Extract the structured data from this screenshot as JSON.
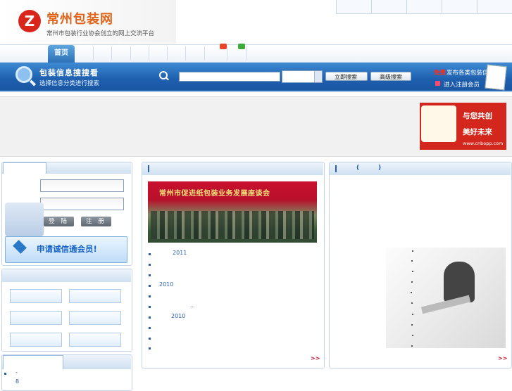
{
  "header": {
    "logo_glyph": "Z",
    "site_name": "常州包装网",
    "slogan": "常州市包装行业协会创立的网上交流平台"
  },
  "nav": {
    "home": "首页"
  },
  "search": {
    "title": "包装信息搜搜看",
    "subtitle": "选择信息分类进行搜索",
    "input_value": "",
    "search_button": "立即搜索",
    "advanced_button": "高级搜索",
    "free_label": "免费",
    "publish_label": "发布各类包装信息",
    "member_label": "进入注册会员"
  },
  "banner_ad": {
    "line1": "与您共创",
    "line2": "美好未来",
    "url": "www.cnbopp.com"
  },
  "login": {
    "login_button": "登 陆",
    "register_button": "注 册",
    "join_label": "申请诚信通会员!"
  },
  "news": {
    "photo_banner": "常州市促进纸包装业务发展座谈会",
    "items": [
      "2011",
      "",
      "",
      "2010",
      "",
      "..",
      "2010",
      "",
      "",
      ""
    ],
    "more": ">>"
  },
  "right": {
    "more": ">>"
  },
  "bottom_left": {
    "items": [
      "-",
      "8"
    ]
  },
  "colors": {
    "brand_orange": "#e0651a",
    "nav_blue": "#2c6fb5",
    "accent_red": "#c8102e"
  }
}
